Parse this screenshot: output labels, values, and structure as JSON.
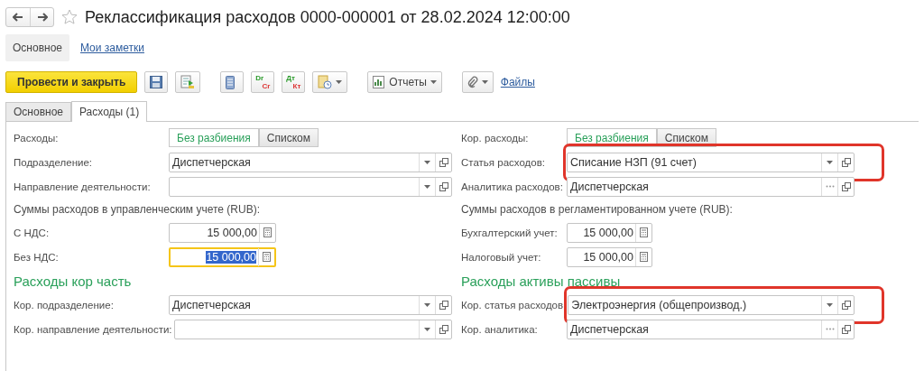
{
  "title": "Реклассификация расходов 0000-000001 от 28.02.2024 12:00:00",
  "panel_tabs": [
    {
      "label": "Основное",
      "selected": true
    },
    {
      "label": "Мои заметки",
      "selected": false
    }
  ],
  "toolbar": [
    {
      "kind": "primary",
      "label": "Провести и закрыть"
    },
    {
      "kind": "save"
    },
    {
      "kind": "post"
    },
    {
      "kind": "gap"
    },
    {
      "kind": "list"
    },
    {
      "kind": "pair",
      "top": "Dr",
      "bottom": "Cr"
    },
    {
      "kind": "pair",
      "top": "Дт",
      "bottom": "Кт"
    },
    {
      "kind": "docmenu"
    },
    {
      "kind": "gap"
    },
    {
      "kind": "menu",
      "label": "Отчеты"
    },
    {
      "kind": "gap"
    },
    {
      "kind": "clip"
    },
    {
      "kind": "link",
      "label": "Файлы"
    }
  ],
  "form_tabs": [
    {
      "label": "Основное",
      "selected": false
    },
    {
      "label": "Расходы (1)",
      "selected": true
    }
  ],
  "left": [
    {
      "kind": "toggle",
      "label": "Расходы:",
      "options": [
        {
          "label": "Без разбиения",
          "selected": true
        },
        {
          "label": "Списком",
          "selected": false
        }
      ]
    },
    {
      "kind": "select",
      "label": "Подразделение:",
      "value": "Диспетчерская",
      "highlighted": false
    },
    {
      "kind": "select",
      "label": "Направление деятельности:",
      "highlighted": false
    },
    {
      "kind": "caption",
      "label": "Суммы расходов в управленческим учете (RUB):"
    },
    {
      "kind": "number",
      "label": "С НДС:",
      "value": "15 000,00",
      "focused": false
    },
    {
      "kind": "number",
      "label": "Без НДС:",
      "value": "15 000,00",
      "focused": true
    },
    {
      "kind": "heading",
      "label": "Расходы кор часть"
    },
    {
      "kind": "select",
      "label": "Кор. подразделение:",
      "value": "Диспетчерская",
      "highlighted": false
    },
    {
      "kind": "select",
      "label": "Кор. направление деятельности:",
      "highlighted": false
    }
  ],
  "right": [
    {
      "kind": "toggle",
      "label": "Кор. расходы:",
      "options": [
        {
          "label": "Без разбиения",
          "selected": true
        },
        {
          "label": "Списком",
          "selected": false
        }
      ]
    },
    {
      "kind": "select",
      "label": "Статья расходов:",
      "value": "Списание НЗП (91 счет)",
      "highlighted": true
    },
    {
      "kind": "picker",
      "label": "Аналитика расходов:",
      "value": "Диспетчерская",
      "highlighted": false
    },
    {
      "kind": "caption",
      "label": "Суммы расходов в регламентированном учете (RUB):"
    },
    {
      "kind": "number",
      "label": "Бухгалтерский учет:",
      "value": "15 000,00",
      "focused": false
    },
    {
      "kind": "number",
      "label": "Налоговый учет:",
      "value": "15 000,00",
      "focused": false
    },
    {
      "kind": "heading",
      "label": "Расходы активы пассивы"
    },
    {
      "kind": "select",
      "label": "Кор. статья расходов:",
      "value": "Электроэнергия (общепроизвод.)",
      "highlighted": true
    },
    {
      "kind": "picker",
      "label": "Кор. аналитика:",
      "value": "Диспетчерская",
      "highlighted": false
    }
  ]
}
